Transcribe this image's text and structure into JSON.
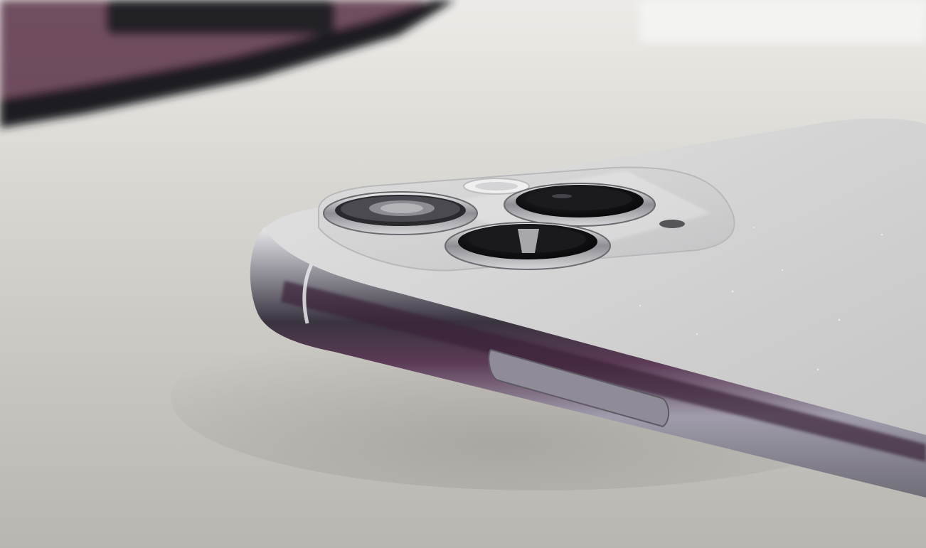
{
  "scene": {
    "subject": "smartphone-rear-camera",
    "colors": {
      "table_light": "#e6e4e0",
      "table_mid": "#cfccc7",
      "table_dark": "#a8a5a0",
      "phone_back": "#d9d9d9",
      "phone_back_highlight": "#eeeeee",
      "frame_steel": "#9a9aa0",
      "frame_dark": "#3c3a42",
      "frame_purple_reflection": "#4a2c4a",
      "lens_ring": "#c8c8cc",
      "lens_glass": "#141416",
      "background_object": "#2a2a2e",
      "background_purple": "#5b3448"
    }
  }
}
